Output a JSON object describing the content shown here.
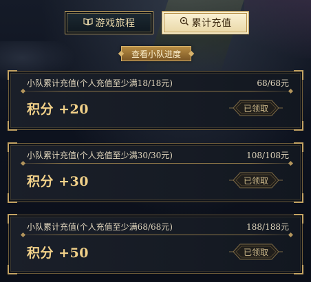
{
  "tabs": [
    {
      "label": "游戏旅程",
      "icon": "book-icon",
      "active": false
    },
    {
      "label": "累计充值",
      "icon": "search-coin-icon",
      "active": true
    }
  ],
  "progress_button": {
    "label": "查看小队进度"
  },
  "cards": [
    {
      "title": "小队累计充值(个人充值至少满18/18元)",
      "amount": "68/68元",
      "points": "积分 +20",
      "status": "已领取"
    },
    {
      "title": "小队累计充值(个人充值至少满30/30元)",
      "amount": "108/108元",
      "points": "积分 +30",
      "status": "已领取"
    },
    {
      "title": "小队累计充值(个人充值至少满68/68元)",
      "amount": "188/188元",
      "points": "积分 +50",
      "status": "已领取"
    }
  ],
  "colors": {
    "gold": "#c5a463",
    "points": "#f2d189",
    "active_tab_bg": "#f3e7c0",
    "panel_bg": "#161b24"
  }
}
